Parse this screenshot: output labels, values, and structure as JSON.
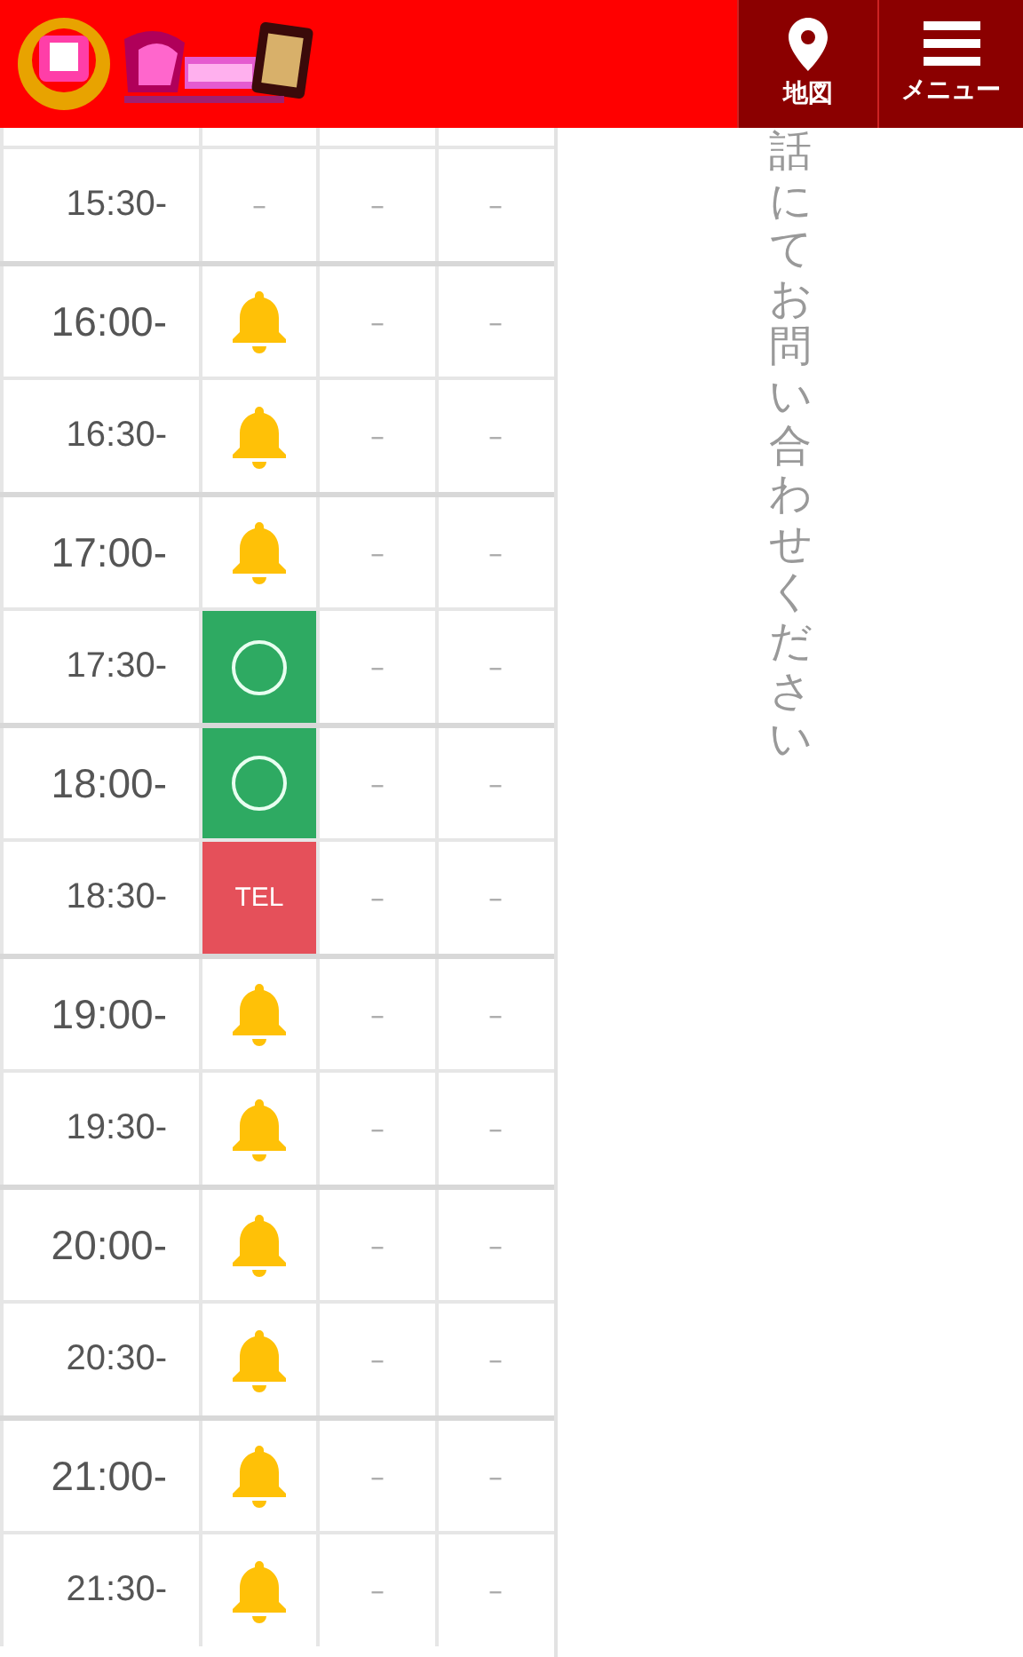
{
  "header": {
    "nav": [
      {
        "kind": "map",
        "label": "地図"
      },
      {
        "kind": "menu",
        "label": "メニュー"
      }
    ]
  },
  "schedule": {
    "rows": [
      {
        "time": "15:30-",
        "major": false,
        "cells": [
          {
            "kind": "dash",
            "text": "–"
          },
          {
            "kind": "dash",
            "text": "–"
          },
          {
            "kind": "dash",
            "text": "–"
          }
        ]
      },
      {
        "time": "16:00-",
        "major": true,
        "cells": [
          {
            "kind": "bell"
          },
          {
            "kind": "dash",
            "text": "–"
          },
          {
            "kind": "dash",
            "text": "–"
          }
        ]
      },
      {
        "time": "16:30-",
        "major": false,
        "cells": [
          {
            "kind": "bell"
          },
          {
            "kind": "dash",
            "text": "–"
          },
          {
            "kind": "dash",
            "text": "–"
          }
        ]
      },
      {
        "time": "17:00-",
        "major": true,
        "cells": [
          {
            "kind": "bell"
          },
          {
            "kind": "dash",
            "text": "–"
          },
          {
            "kind": "dash",
            "text": "–"
          }
        ]
      },
      {
        "time": "17:30-",
        "major": false,
        "cells": [
          {
            "kind": "open"
          },
          {
            "kind": "dash",
            "text": "–"
          },
          {
            "kind": "dash",
            "text": "–"
          }
        ]
      },
      {
        "time": "18:00-",
        "major": true,
        "cells": [
          {
            "kind": "open"
          },
          {
            "kind": "dash",
            "text": "–"
          },
          {
            "kind": "dash",
            "text": "–"
          }
        ]
      },
      {
        "time": "18:30-",
        "major": false,
        "cells": [
          {
            "kind": "tel",
            "text": "TEL"
          },
          {
            "kind": "dash",
            "text": "–"
          },
          {
            "kind": "dash",
            "text": "–"
          }
        ]
      },
      {
        "time": "19:00-",
        "major": true,
        "cells": [
          {
            "kind": "bell"
          },
          {
            "kind": "dash",
            "text": "–"
          },
          {
            "kind": "dash",
            "text": "–"
          }
        ]
      },
      {
        "time": "19:30-",
        "major": false,
        "cells": [
          {
            "kind": "bell"
          },
          {
            "kind": "dash",
            "text": "–"
          },
          {
            "kind": "dash",
            "text": "–"
          }
        ]
      },
      {
        "time": "20:00-",
        "major": true,
        "cells": [
          {
            "kind": "bell"
          },
          {
            "kind": "dash",
            "text": "–"
          },
          {
            "kind": "dash",
            "text": "–"
          }
        ]
      },
      {
        "time": "20:30-",
        "major": false,
        "cells": [
          {
            "kind": "bell"
          },
          {
            "kind": "dash",
            "text": "–"
          },
          {
            "kind": "dash",
            "text": "–"
          }
        ]
      },
      {
        "time": "21:00-",
        "major": true,
        "cells": [
          {
            "kind": "bell"
          },
          {
            "kind": "dash",
            "text": "–"
          },
          {
            "kind": "dash",
            "text": "–"
          }
        ]
      },
      {
        "time": "21:30-",
        "major": false,
        "cells": [
          {
            "kind": "bell"
          },
          {
            "kind": "dash",
            "text": "–"
          },
          {
            "kind": "dash",
            "text": "–"
          }
        ]
      }
    ]
  },
  "note": "話にてお問い合わせください"
}
